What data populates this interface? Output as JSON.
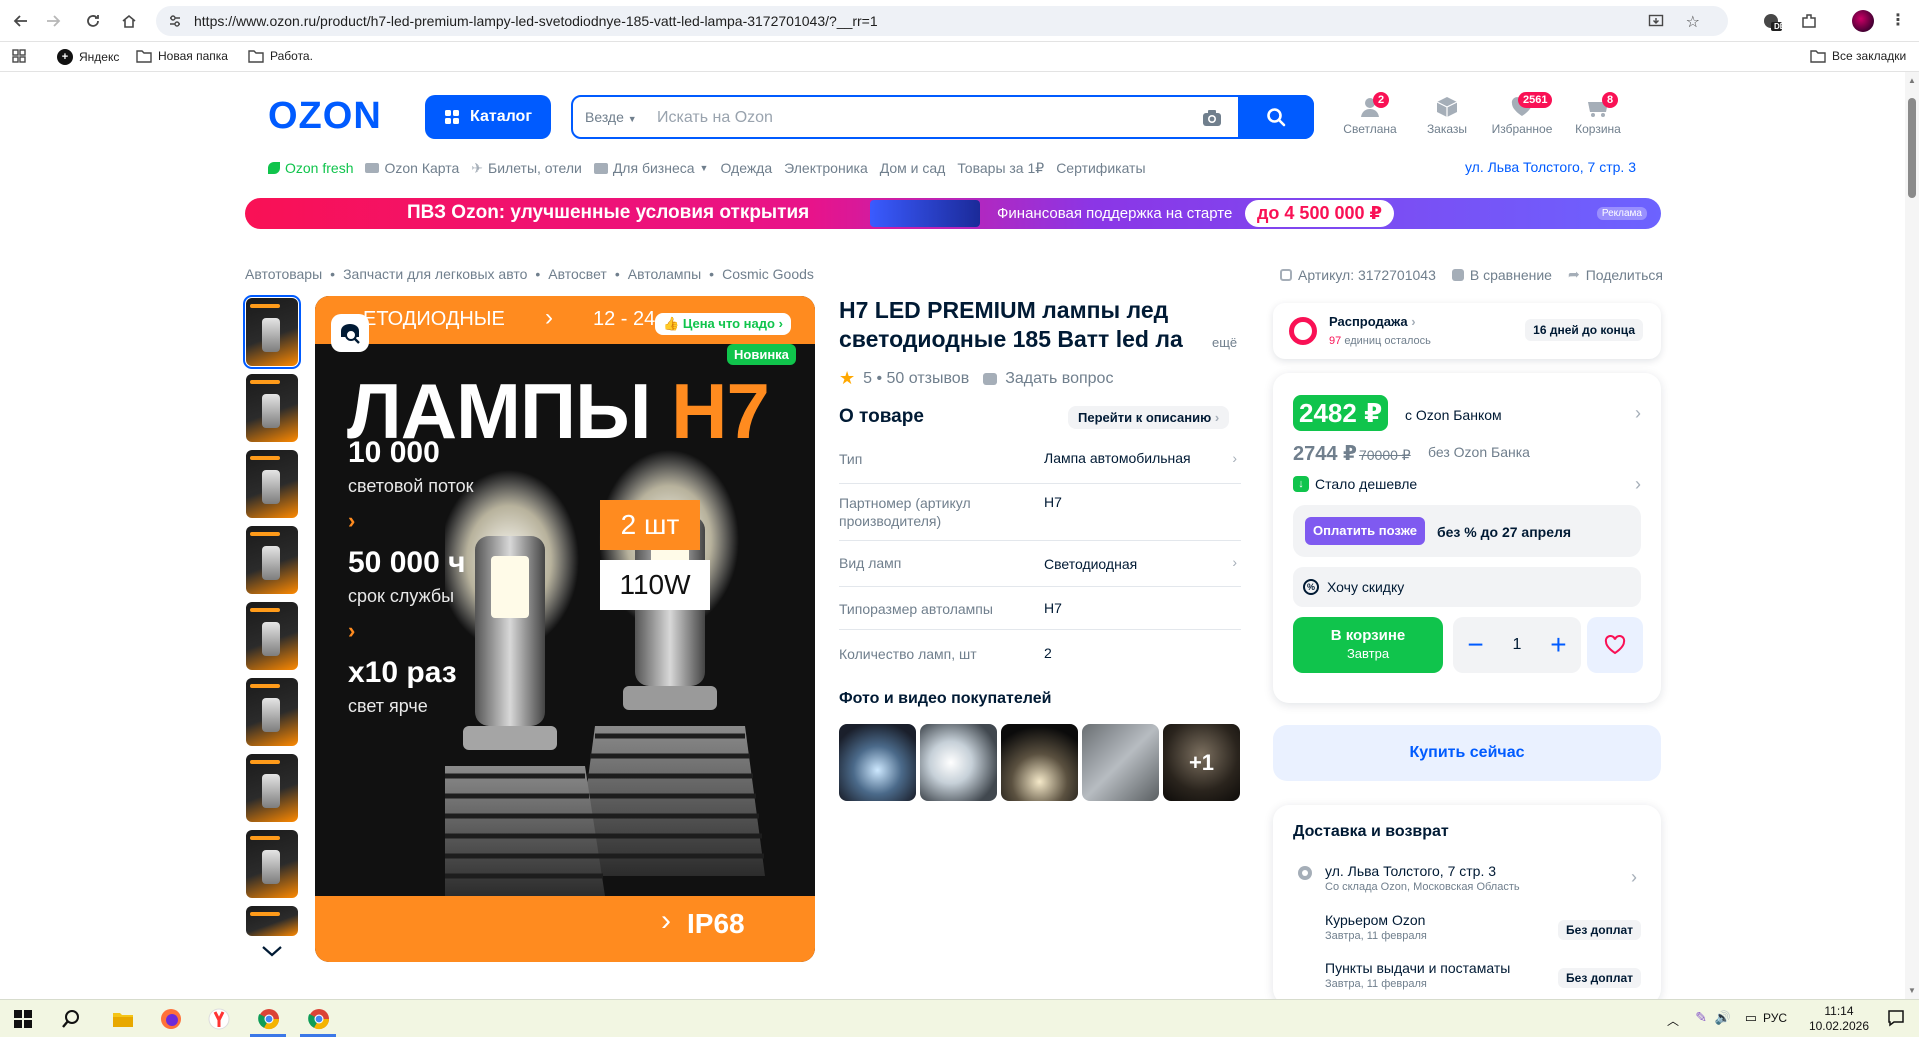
{
  "browser": {
    "url": "https://www.ozon.ru/product/h7-led-premium-lampy-led-svetodiodnye-185-vatt-led-lampa-3172701043/?__rr=1",
    "bookmarks": [
      "Яндекс",
      "Новая папка",
      "Работа."
    ],
    "all_bookmarks": "Все закладки",
    "profile_badge": "DE"
  },
  "header": {
    "logo": "OZON",
    "catalog_label": "Каталог",
    "search_scope": "Везде",
    "search_placeholder": "Искать на Ozon",
    "icons": [
      {
        "label": "Светлана",
        "badge": "2",
        "icon": "user-icon"
      },
      {
        "label": "Заказы",
        "badge": "",
        "icon": "box-icon"
      },
      {
        "label": "Избранное",
        "badge": "2561",
        "icon": "heart-icon"
      },
      {
        "label": "Корзина",
        "badge": "8",
        "icon": "cart-icon"
      }
    ],
    "subnav": [
      "Ozon fresh",
      "Ozon Карта",
      "Билеты, отели",
      "Для бизнеса",
      "Одежда",
      "Электроника",
      "Дом и сад",
      "Товары за 1₽",
      "Сертификаты"
    ],
    "address": "ул. Льва Толстого, 7 стр. 3"
  },
  "banner": {
    "title": "ПВЗ Ozon: улучшенные условия открытия",
    "text": "Финансовая поддержка на старте",
    "amount": "до 4 500 000 ₽",
    "ad": "Реклама",
    "colors": [
      "#f91155",
      "#8b36e6",
      "#6c63ff"
    ]
  },
  "breadcrumbs": [
    "Автотовары",
    "Запчасти для легковых авто",
    "Автосвет",
    "Автолампы",
    "Cosmic Goods"
  ],
  "product_actions": {
    "article": "Артикул: 3172701043",
    "compare": "В сравнение",
    "share": "Поделиться"
  },
  "image": {
    "top_text": "ЕТОДИОДНЫЕ",
    "top_text2": "12 - 24",
    "price_tag": "Цена что надо",
    "new_badge": "Новинка",
    "title_main": "ЛАМПЫ",
    "title_accent": "H7",
    "stats": [
      {
        "num": "10 000",
        "sub": "световой поток"
      },
      {
        "num": "50 000 ч",
        "sub": "срок службы"
      },
      {
        "num": "x10 раз",
        "sub": "свет ярче"
      }
    ],
    "qty_badge": "2 шт",
    "watt_badge": "110W",
    "ip_label": "IP68"
  },
  "product": {
    "title": "H7 LED PREMIUM лампы лед светодиодные 185 Ватт led ла",
    "more": "ещё",
    "rating": "5 • 50 отзывов",
    "ask": "Задать вопрос",
    "about_heading": "О товаре",
    "goto_desc": "Перейти к описанию",
    "specs": [
      {
        "key": "Тип",
        "value": "Лампа автомобильная"
      },
      {
        "key": "Партномер (артикул производителя)",
        "value": "H7"
      },
      {
        "key": "Вид ламп",
        "value": "Светодиодная"
      },
      {
        "key": "Типоразмер автолампы",
        "value": "H7"
      },
      {
        "key": "Количество ламп, шт",
        "value": "2"
      }
    ],
    "photos_heading": "Фото и видео покупателей",
    "photos_more": "+1"
  },
  "sale": {
    "title": "Распродажа",
    "left_count": "97",
    "left_text": "единиц осталось",
    "days": "16 дней до конца"
  },
  "buy": {
    "price_bank": "2482 ₽",
    "price_bank_label": "с Ozon Банком",
    "price_regular": "2744 ₽",
    "price_old": "70000 ₽",
    "price_regular_label": "без Ozon Банка",
    "cheaper": "Стало дешевле",
    "pay_later_btn": "Оплатить позже",
    "pay_later_text": "без % до 27 апреля",
    "want_discount": "Хочу скидку",
    "in_cart": "В корзине",
    "in_cart_sub": "Завтра",
    "qty": "1",
    "buy_now": "Купить сейчас"
  },
  "delivery": {
    "heading": "Доставка и возврат",
    "rows": [
      {
        "title": "ул. Льва Толстого, 7 стр. 3",
        "sub": "Со склада Ozon, Московская Область",
        "badge": ""
      },
      {
        "title": "Курьером Ozon",
        "sub": "Завтра, 11 февраля",
        "badge": "Без доплат"
      },
      {
        "title": "Пункты выдачи и постаматы",
        "sub": "Завтра, 11 февраля",
        "badge": "Без доплат"
      }
    ]
  },
  "taskbar": {
    "lang": "РУС",
    "time": "11:14",
    "date": "10.02.2026"
  }
}
